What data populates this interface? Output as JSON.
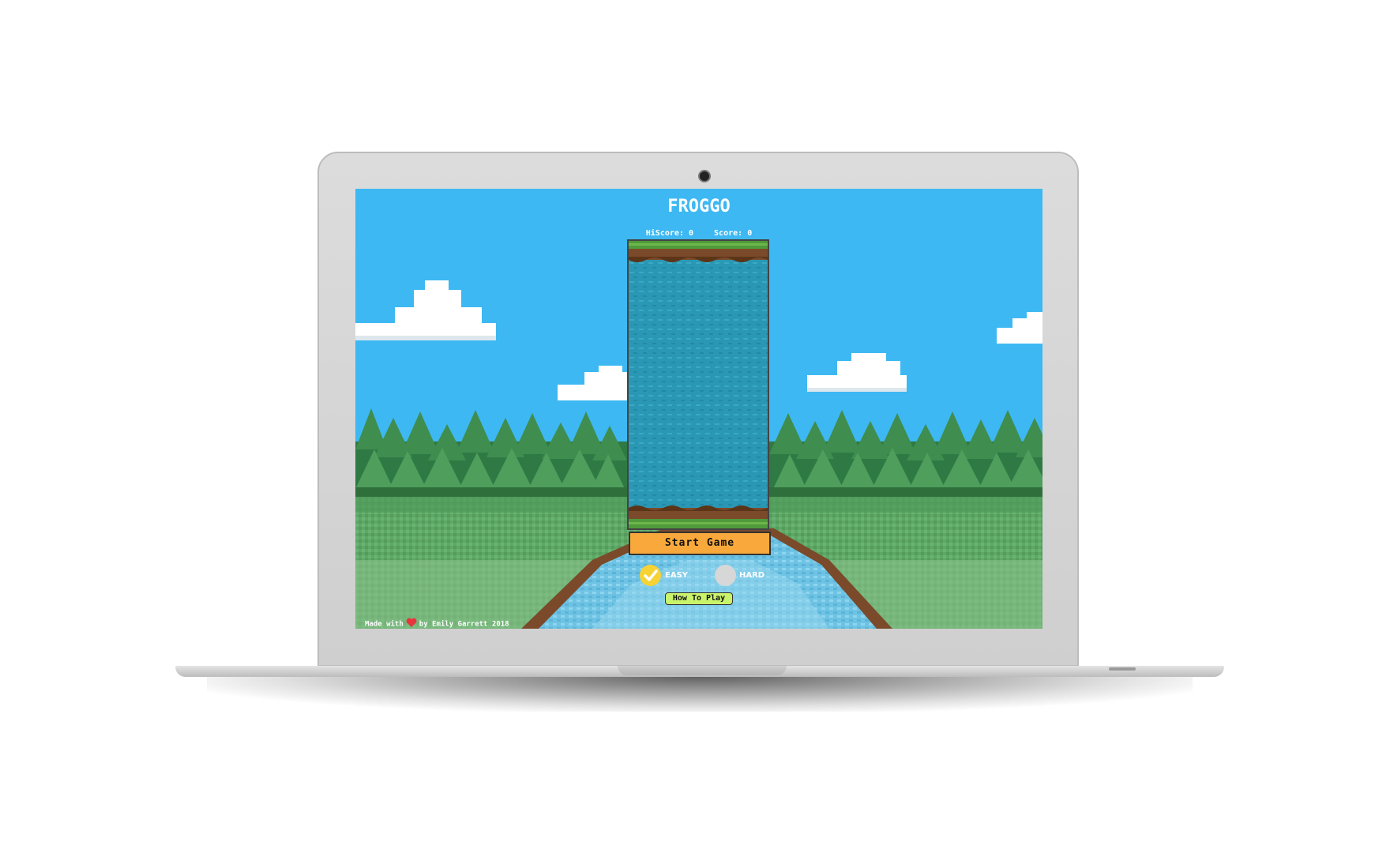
{
  "game": {
    "title": "FROGGO",
    "hiscore_label": "HiScore:",
    "hiscore_value": "0",
    "score_label": "Score:",
    "score_value": "0"
  },
  "controls": {
    "start_label": "Start Game",
    "easy_label": "EASY",
    "hard_label": "HARD",
    "selected_difficulty": "easy",
    "howto_label": "How To Play"
  },
  "footer": {
    "made_with": "Made with",
    "by_text": "by Emily Garrett 2018"
  },
  "colors": {
    "sky": "#3db8f2",
    "start_button": "#f9a93b",
    "easy_selected": "#f6d235",
    "hard_unselected": "#d7d7d7",
    "howto_button": "#c9f36a",
    "heart": "#e8343c"
  },
  "icons": [
    "checkmark-icon",
    "heart-icon"
  ]
}
